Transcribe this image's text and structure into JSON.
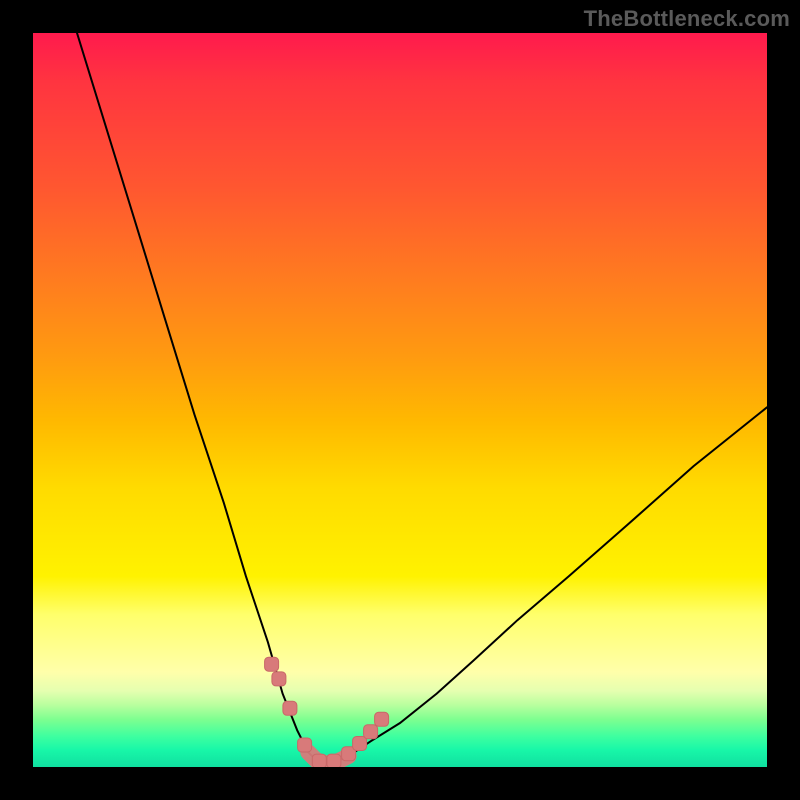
{
  "watermark": "TheBottleneck.com",
  "chart_data": {
    "type": "line",
    "title": "",
    "xlabel": "",
    "ylabel": "",
    "xlim": [
      0,
      100
    ],
    "ylim": [
      0,
      100
    ],
    "grid": false,
    "legend": false,
    "background_gradient": {
      "orientation": "vertical",
      "stops": [
        {
          "pos": 0.0,
          "color": "#ff1a4d"
        },
        {
          "pos": 0.15,
          "color": "#ff3440"
        },
        {
          "pos": 0.35,
          "color": "#ff7a20"
        },
        {
          "pos": 0.55,
          "color": "#ffb900"
        },
        {
          "pos": 0.72,
          "color": "#fff200"
        },
        {
          "pos": 0.85,
          "color": "#ffffaa"
        },
        {
          "pos": 0.92,
          "color": "#7dff90"
        },
        {
          "pos": 1.0,
          "color": "#10e0a0"
        }
      ]
    },
    "series": [
      {
        "name": "bottleneck-curve",
        "x": [
          6,
          10,
          14,
          18,
          22,
          26,
          29,
          32,
          34,
          36,
          37.5,
          39,
          41,
          43,
          46,
          50,
          55,
          60,
          66,
          73,
          81,
          90,
          100
        ],
        "y": [
          100,
          87,
          74,
          61,
          48,
          36,
          26,
          17,
          10,
          5,
          2,
          0.5,
          0.5,
          1.5,
          3.5,
          6,
          10,
          14.5,
          20,
          26,
          33,
          41,
          49
        ],
        "markers": {
          "x": [
            32.5,
            33.5,
            35,
            37,
            39,
            41,
            43,
            44.5,
            46,
            47.5
          ],
          "y": [
            14,
            12,
            8,
            3,
            0.8,
            0.8,
            1.8,
            3.2,
            4.8,
            6.5
          ]
        },
        "highlight_segment": {
          "x_start": 37,
          "x_end": 43
        }
      }
    ]
  }
}
